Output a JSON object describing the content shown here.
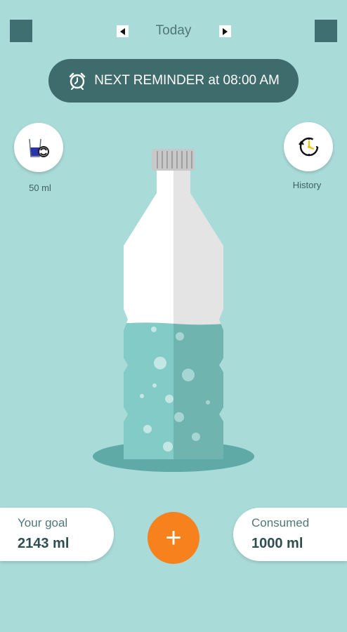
{
  "header": {
    "date_label": "Today"
  },
  "reminder": {
    "label": "NEXT REMINDER at 08:00 AM",
    "icon": "alarm-clock-icon"
  },
  "cup_selector": {
    "icon": "cup-icon",
    "label": "50 ml"
  },
  "history": {
    "icon": "history-clock-icon",
    "label": "History"
  },
  "bottle": {
    "fill_fraction": 0.47
  },
  "stats": {
    "goal_title": "Your goal",
    "goal_value": "2143 ml",
    "consumed_title": "Consumed",
    "consumed_value": "1000 ml"
  },
  "add_button": {
    "label": "+"
  },
  "colors": {
    "background": "#a9dbd8",
    "dark_teal": "#3e6b6b",
    "water": "#79c7c3",
    "accent_orange": "#f7821d"
  }
}
